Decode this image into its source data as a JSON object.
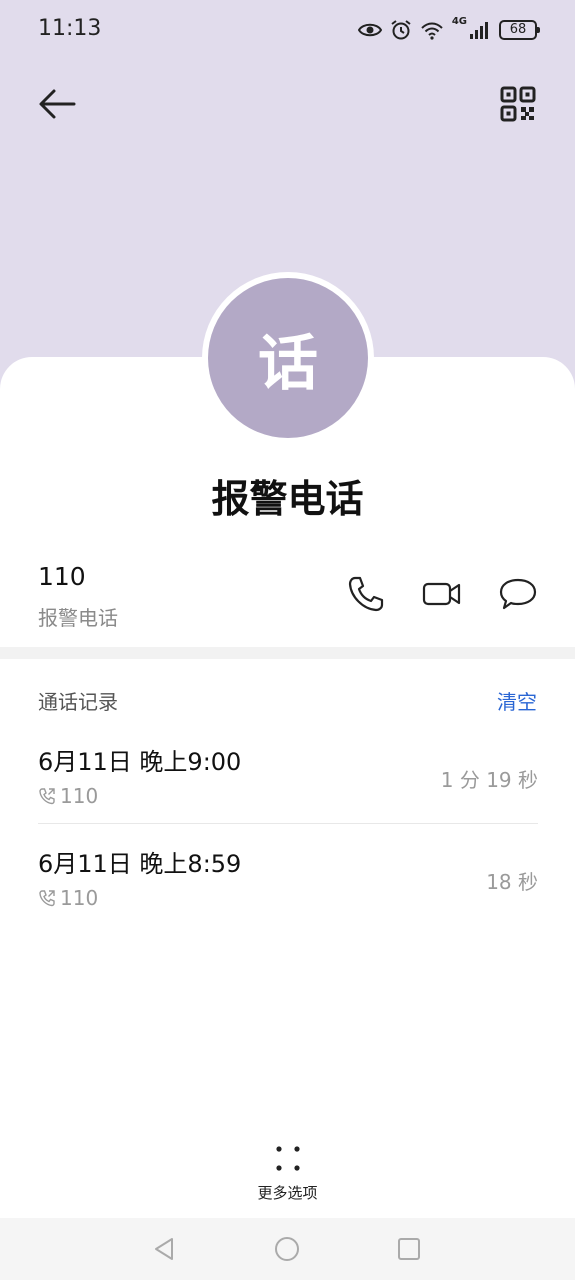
{
  "status_bar": {
    "time": "11:13",
    "battery": "68",
    "network": "4G"
  },
  "contact": {
    "avatar_char": "话",
    "name": "报警电话",
    "number": "110",
    "number_label": "报警电话"
  },
  "call_log": {
    "title": "通话记录",
    "clear_label": "清空",
    "entries": [
      {
        "date": "6月11日 晚上9:00",
        "number": "110",
        "duration": "1 分 19 秒"
      },
      {
        "date": "6月11日 晚上8:59",
        "number": "110",
        "duration": "18 秒"
      }
    ]
  },
  "more_options_label": "更多选项",
  "colors": {
    "header_bg": "#e1dcec",
    "avatar_bg": "#b3a9c6",
    "accent": "#2a66d4"
  },
  "icons": [
    "back-arrow-icon",
    "qr-code-icon",
    "phone-icon",
    "video-call-icon",
    "message-icon",
    "call-outgoing-icon",
    "more-dots-icon",
    "nav-back-icon",
    "nav-home-icon",
    "nav-recents-icon"
  ]
}
